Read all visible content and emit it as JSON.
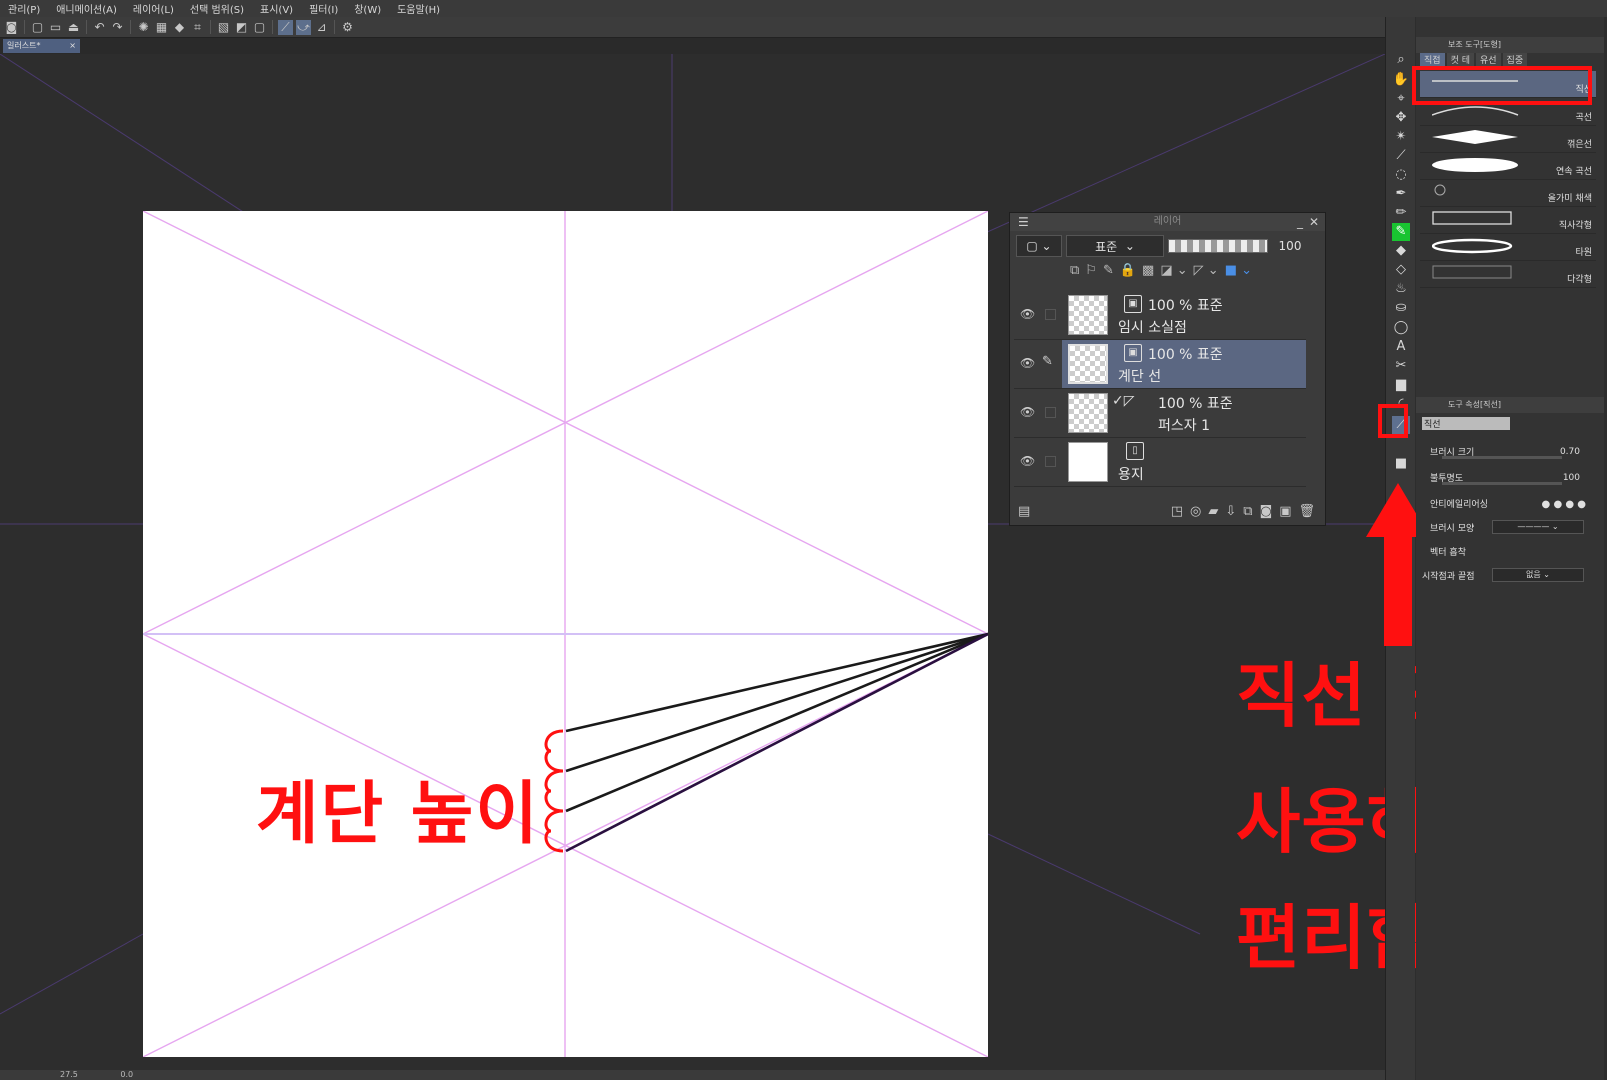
{
  "menu": [
    "관리(P)",
    "애니메이션(A)",
    "레이어(L)",
    "선택 범위(S)",
    "표시(V)",
    "필터(I)",
    "창(W)",
    "도움말(H)"
  ],
  "document_tab": {
    "label": "일러스트*",
    "close": "×"
  },
  "annotations": {
    "step_height": "계단 높이",
    "tip_line1": "직선 도구를",
    "tip_line2": "사용하면",
    "tip_line3": "편리합니다."
  },
  "layer_panel": {
    "title": "레이어",
    "blend_mode": "표준",
    "opacity": "100",
    "layers": [
      {
        "mode": "100 % 표준",
        "name": "임시 소실점",
        "selected": false,
        "icon": "cube-icon"
      },
      {
        "mode": "100 % 표준",
        "name": "계단 선",
        "selected": true,
        "icon": "cube-icon"
      },
      {
        "mode": "100 % 표준",
        "name": "퍼스자 1",
        "selected": false,
        "icon": "perspective-ruler-icon"
      },
      {
        "mode": "",
        "name": "용지",
        "selected": false,
        "icon": "paper-icon"
      }
    ]
  },
  "sub_tool_panel": {
    "header": "보조 도구[도형]",
    "tabs": [
      "직접",
      "컷 테",
      "유선",
      "집중"
    ],
    "brushes": [
      "직선",
      "곡선",
      "꺾은선",
      "연속 곡선",
      "올가미 채색",
      "직사각형",
      "타원",
      "다각형"
    ]
  },
  "tool_property": {
    "header": "도구 속성[직선]",
    "tool_name": "직선",
    "brush_size_label": "브러시 크기",
    "brush_size_value": "0.70",
    "opacity_label": "불투명도",
    "opacity_value": "100",
    "antialias_label": "안티에일리어싱",
    "brush_shape_label": "브러시 모양",
    "vector_snap_label": "벡터 흡착",
    "start_end_label": "시작점과 끝점",
    "start_end_value": "없음"
  },
  "status": {
    "zoom": "27.5",
    "angle": "0.0"
  },
  "colors": {
    "accent": "#5b6782",
    "annotation_red": "#ff1010",
    "guide_pink": "#e8a6f0"
  }
}
